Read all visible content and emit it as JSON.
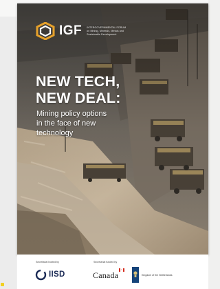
{
  "cover": {
    "org_acronym": "IGF",
    "org_fullname_line1": "INTERGOVERNMENTAL FORUM",
    "org_fullname_line2": "on Mining, Minerals, Metals and",
    "org_fullname_line3": "Sustainable Development",
    "title_line1": "NEW TECH,",
    "title_line2": "NEW DEAL:",
    "subtitle_line1": "Mining policy options",
    "subtitle_line2": "in the face of new",
    "subtitle_line3": "technology"
  },
  "footer": {
    "supported_label_1": "Secretariat hosted by",
    "supported_label_2": "Secretariat funded by",
    "iisd_logo_text": "IISD",
    "canada_logo_text": "Canada",
    "netherlands_text": "Kingdom of the Netherlands"
  },
  "colors": {
    "title": "#ffffff",
    "iisd_blue": "#1a2a55",
    "netherlands_blue": "#15447a",
    "canada_red": "#d52b1e"
  },
  "icons": [
    "igf-logo-icon",
    "iisd-ring-icon",
    "canada-flag-icon",
    "netherlands-crest-icon"
  ]
}
